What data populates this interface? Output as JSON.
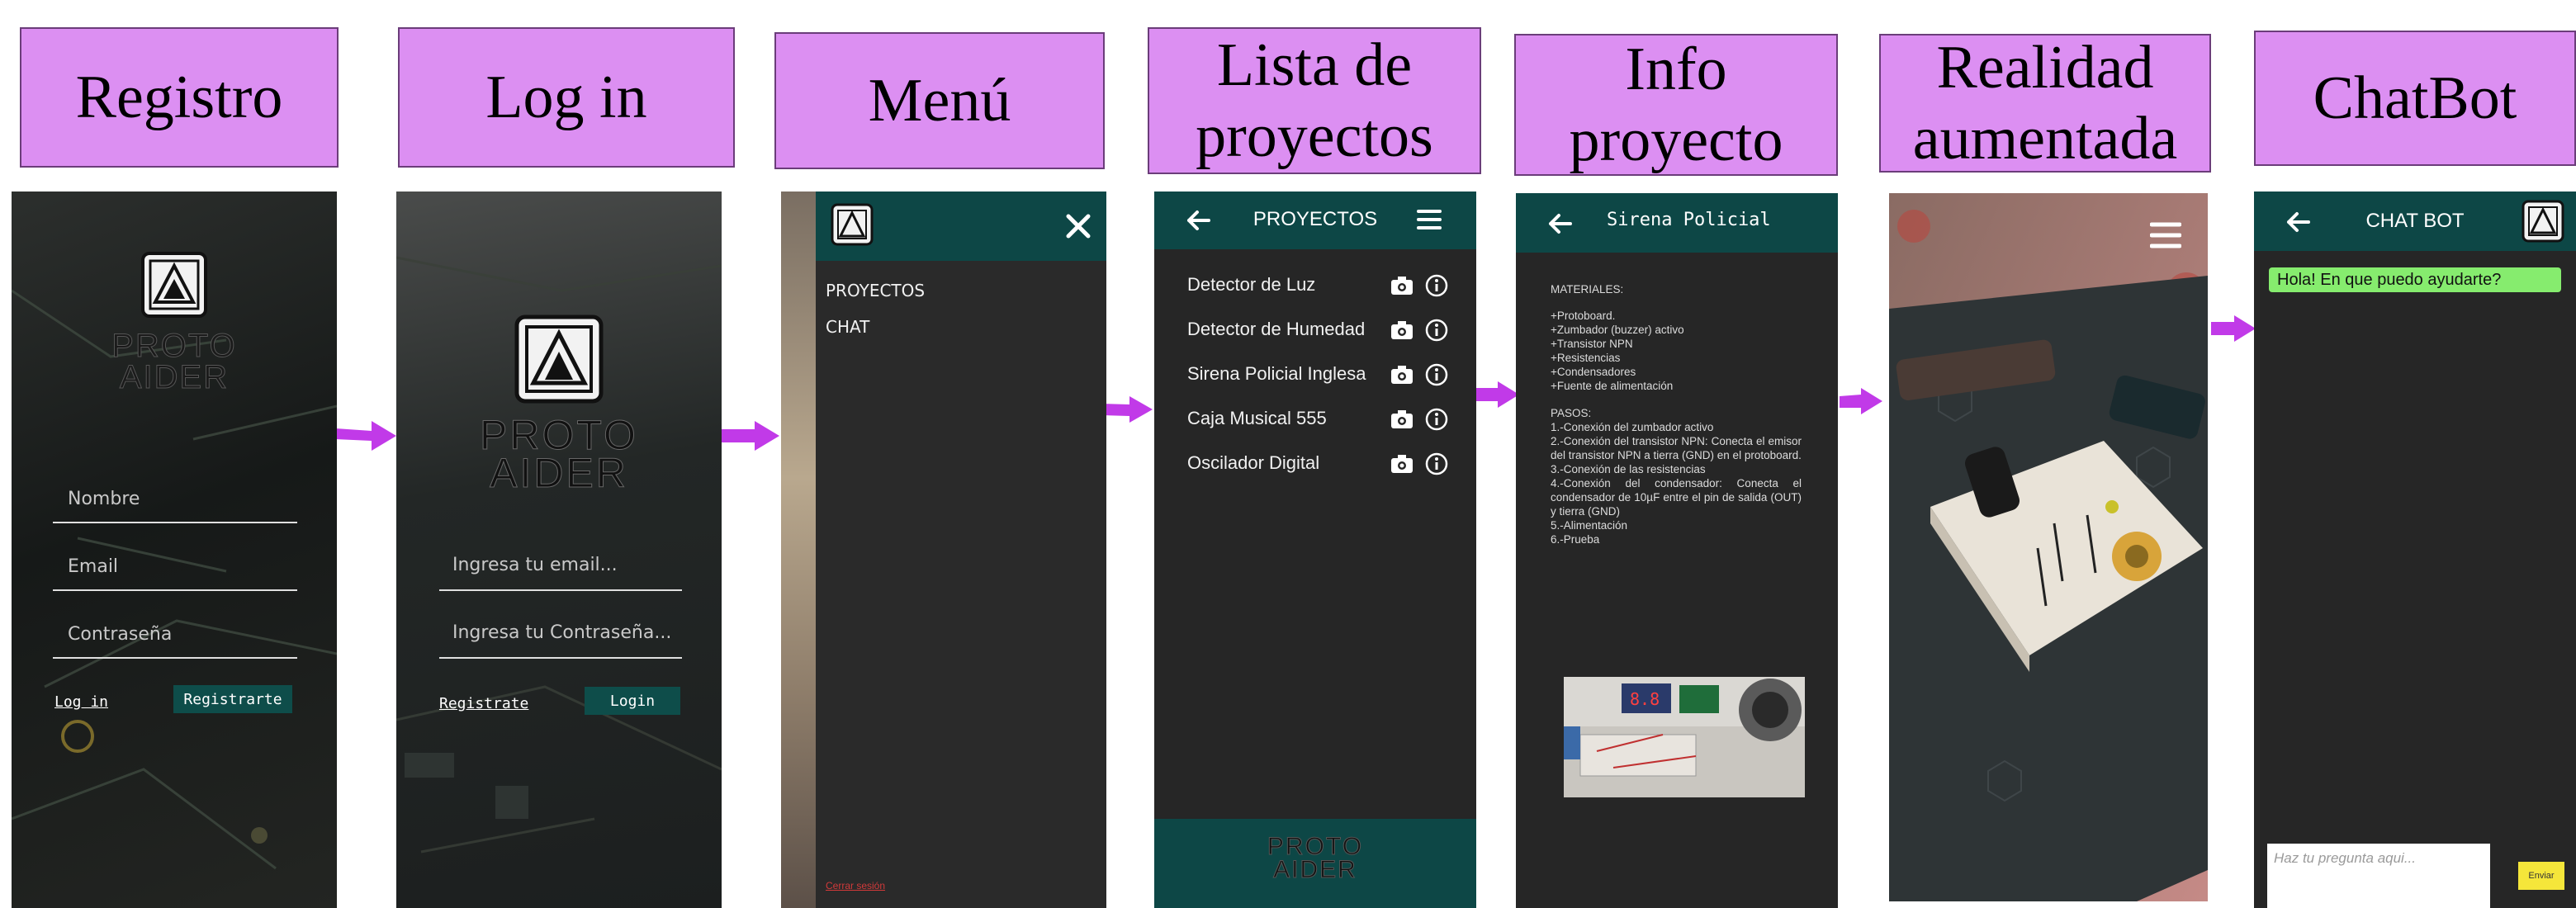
{
  "labels": {
    "registro": "Registro",
    "login": "Log in",
    "menu": "Menú",
    "lista_line1": "Lista de",
    "lista_line2": "proyectos",
    "info_line1": "Info",
    "info_line2": "proyecto",
    "ra_line1": "Realidad",
    "ra_line2": "aumentada",
    "chatbot": "ChatBot"
  },
  "brand": {
    "line1": "PROTO",
    "line2": "AIDER"
  },
  "registro": {
    "nombre_placeholder": "Nombre",
    "email_placeholder": "Email",
    "password_placeholder": "Contraseña",
    "login_link": "Log in",
    "register_button": "Registrarte"
  },
  "login": {
    "email_placeholder": "Ingresa tu email...",
    "password_placeholder": "Ingresa tu Contraseña...",
    "register_link": "Registrate",
    "login_button": "Login"
  },
  "menu": {
    "items": [
      "PROYECTOS",
      "CHAT"
    ],
    "logout": "Cerrar sesión"
  },
  "proyectos": {
    "title": "PROYECTOS",
    "items": [
      "Detector de Luz",
      "Detector de Humedad",
      "Sirena Policial Inglesa",
      "Caja Musical 555",
      "Oscilador Digital"
    ]
  },
  "info": {
    "title": "Sirena Policial",
    "materiales_title": "MATERIALES:",
    "materiales": "+Protoboard.\n+Zumbador (buzzer) activo\n+Transistor NPN\n+Resistencias\n+Condensadores\n+Fuente de alimentación",
    "pasos_title": "PASOS:",
    "pasos": "1.-Conexión del zumbador activo\n2.-Conexión del transistor NPN: Conecta el emisor del transistor NPN a tierra (GND) en el protoboard.\n3.-Conexión de las resistencias\n4.-Conexión del condensador: Conecta el condensador de 10µF entre el pin de salida (OUT) y tierra (GND)\n5.-Alimentación\n6.-Prueba"
  },
  "chat": {
    "title": "CHAT BOT",
    "greeting": "Hola! En que puedo ayudarte?",
    "input_placeholder": "Haz tu pregunta aqui...",
    "send_button": "Enviar"
  },
  "colors": {
    "label_bg": "#dc8ff2",
    "arrow": "#c13ae8",
    "teal": "#0d4746",
    "chat_bubble": "#86ec6e",
    "send": "#f5e63a"
  },
  "icons": [
    "back-arrow-icon",
    "menu-icon",
    "close-icon",
    "camera-icon",
    "info-icon",
    "logo-icon"
  ]
}
